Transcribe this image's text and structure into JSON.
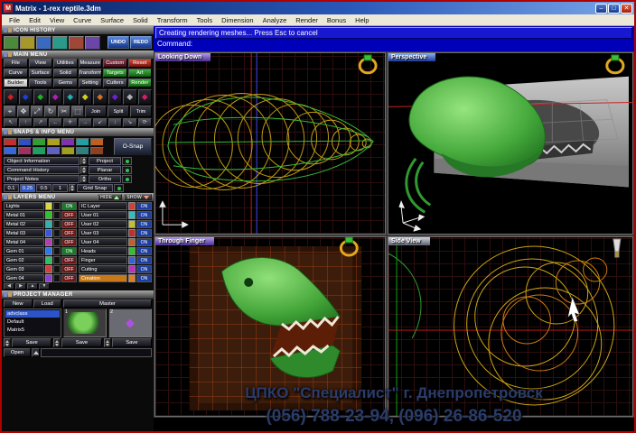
{
  "window": {
    "icon": "M",
    "title": "Matrix - 1-rex reptile.3dm",
    "min": "–",
    "max": "□",
    "close": "✕"
  },
  "menu": {
    "items": [
      "File",
      "Edit",
      "View",
      "Curve",
      "Surface",
      "Solid",
      "Transform",
      "Tools",
      "Dimension",
      "Analyze",
      "Render",
      "Bonus",
      "Help"
    ]
  },
  "command": {
    "status": "Creating rendering meshes... Press Esc to cancel",
    "prompt": "Command:"
  },
  "left_panel": {
    "icon_history": {
      "title": "ICON HISTORY",
      "icons": [
        "#4a8a3a",
        "#a8982a",
        "#3a6ac0",
        "#2a9a8a",
        "#a04838",
        "#6a46a8",
        "#88a040"
      ],
      "undo": "UNDO",
      "redo": "REDO"
    },
    "main_menu": {
      "title": "MAIN MENU",
      "rows": [
        [
          "File",
          "View",
          "Utilities",
          "Measure",
          "Custom",
          "Reset"
        ],
        [
          "Curve",
          "Surface",
          "Solid",
          "Transform",
          "Targets",
          "Art"
        ],
        [
          "Builder",
          "Tools",
          "Gems",
          "Setting",
          "Cutters",
          "Render"
        ]
      ]
    },
    "gems": {
      "glyph": "◆",
      "colors": [
        "#d02020",
        "#2040d0",
        "#20b020",
        "#b020b0",
        "#20b0b0",
        "#d0d020",
        "#d07020",
        "#7020d0",
        "#b0b0b0",
        "#d02060"
      ]
    },
    "tools": {
      "glyphs": [
        "⌖",
        "✥",
        "⤢",
        "↻",
        "✂",
        "⬚"
      ],
      "join": "Join",
      "split": "Split",
      "trim": "Trim"
    },
    "mini_icons": {
      "glyphs": [
        "↖",
        "↑",
        "↗",
        "←",
        "✛",
        "→",
        "↙",
        "↓",
        "↘",
        "⟳"
      ]
    },
    "snaps": {
      "title": "SNAPS & INFO MENU",
      "cell_colors": [
        "#c03030",
        "#3050c0",
        "#30a030",
        "#b0a020",
        "#8030b0",
        "#20a0a0",
        "#c06020",
        "#3868d8",
        "#a03060",
        "#20a060",
        "#6060c0",
        "#a0a020",
        "#308080",
        "#904020"
      ],
      "osnap": "O-Snap",
      "rows": [
        {
          "left": "Object Information",
          "right": "Project"
        },
        {
          "left": "Command History",
          "right": "Planar"
        },
        {
          "left": "Project Notes",
          "right": "Ortho"
        }
      ],
      "grid_values": [
        "0.1",
        "0.25",
        "0.5",
        "1"
      ],
      "grid_snap": "Grid Snap"
    },
    "layers": {
      "title": "LAYERS MENU",
      "hide": "HIDE",
      "show": "SHOW",
      "left_rows": [
        {
          "name": "Lights",
          "swatch": "#d8d840",
          "state": "ON",
          "state_bg": "#1a7a2a"
        },
        {
          "name": "Metal 01",
          "swatch": "#30c030",
          "state": "OFF",
          "state_bg": "#6e1818"
        },
        {
          "name": "Metal 02",
          "swatch": "#30b0b0",
          "state": "OFF",
          "state_bg": "#6e1818"
        },
        {
          "name": "Metal 03",
          "swatch": "#3858d8",
          "state": "OFF",
          "state_bg": "#6e1818"
        },
        {
          "name": "Metal 04",
          "swatch": "#b040b0",
          "state": "OFF",
          "state_bg": "#6e1818"
        },
        {
          "name": "Gem 01",
          "swatch": "#3078e8",
          "state": "ON",
          "state_bg": "#1a7a2a"
        },
        {
          "name": "Gem 02",
          "swatch": "#30c060",
          "state": "OFF",
          "state_bg": "#6e1818"
        },
        {
          "name": "Gem 03",
          "swatch": "#d04040",
          "state": "OFF",
          "state_bg": "#6e1818"
        },
        {
          "name": "Gem 04",
          "swatch": "#9040d0",
          "state": "OFF",
          "state_bg": "#6e1818"
        }
      ],
      "right_rows": [
        {
          "name": "IC Layer",
          "swatch": "#d04040",
          "state": "ON",
          "state_bg": "#1e3fa0"
        },
        {
          "name": "User 01",
          "swatch": "#30c0c0",
          "state": "ON",
          "state_bg": "#1e3fa0"
        },
        {
          "name": "User 02",
          "swatch": "#c0c030",
          "state": "ON",
          "state_bg": "#1e3fa0"
        },
        {
          "name": "User 03",
          "swatch": "#c03030",
          "state": "ON",
          "state_bg": "#1e3fa0"
        },
        {
          "name": "User 04",
          "swatch": "#c06030",
          "state": "ON",
          "state_bg": "#1e3fa0"
        },
        {
          "name": "Heads",
          "swatch": "#30c030",
          "state": "ON",
          "state_bg": "#1e3fa0"
        },
        {
          "name": "Finger",
          "swatch": "#3860d8",
          "state": "ON",
          "state_bg": "#1e3fa0"
        },
        {
          "name": "Cutting",
          "swatch": "#c030c0",
          "state": "ON",
          "state_bg": "#1e3fa0"
        },
        {
          "name": "Creation",
          "swatch": "#e08020",
          "state": "ON",
          "state_bg": "#1e3fa0",
          "name_bg": "#c87818"
        }
      ]
    },
    "project_manager": {
      "title": "PROJECT MANAGER",
      "new": "New",
      "load": "Load",
      "master": "Master",
      "thumb1": "1",
      "thumb2": "2",
      "items": [
        "advclass",
        "Default",
        "Matrix5"
      ],
      "save": "Save",
      "open": "Open"
    }
  },
  "viewports": {
    "top_left": {
      "title": "Looking Down"
    },
    "top_right": {
      "title": "Perspective"
    },
    "bottom_left": {
      "title": "Through Finger"
    },
    "bottom_right": {
      "title": "Side View"
    }
  },
  "watermark": {
    "line1": "ЦПКО \"Специалист\" г. Днепропетровск",
    "line2": "(056) 788-23-94, (096) 26-86-520"
  }
}
